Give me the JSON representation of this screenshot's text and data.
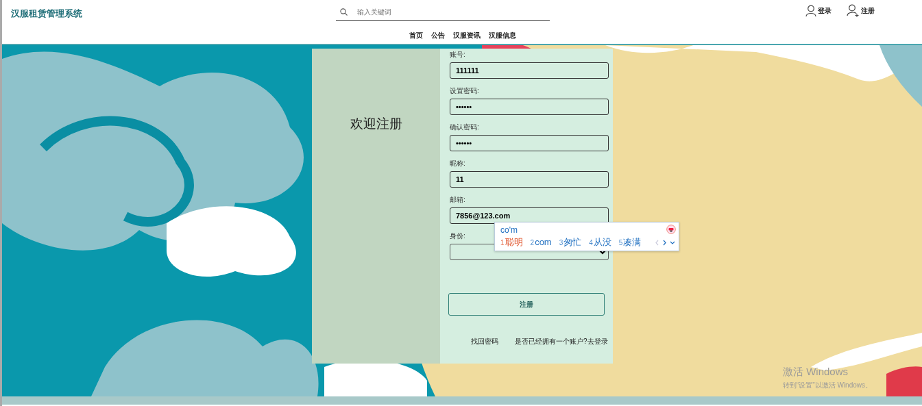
{
  "header": {
    "brand": "汉服租赁管理系统",
    "search": {
      "placeholder": "输入关键词"
    },
    "nav": [
      "首页",
      "公告",
      "汉服资讯",
      "汉服信息"
    ],
    "user_links": [
      {
        "kind": "login",
        "label": "登录"
      },
      {
        "kind": "register",
        "label": "注册"
      }
    ]
  },
  "form": {
    "title": "欢迎注册",
    "fields": [
      {
        "kind": "text",
        "label": "账号:",
        "value": "111111"
      },
      {
        "kind": "password",
        "label": "设置密码:",
        "value": "••••••"
      },
      {
        "kind": "password",
        "label": "确认密码:",
        "value": "••••••"
      },
      {
        "kind": "text",
        "label": "昵称:",
        "value": "11"
      },
      {
        "kind": "text",
        "label": "邮箱:",
        "value": "7856@123.com"
      },
      {
        "kind": "select",
        "label": "身份:"
      }
    ],
    "submit": "注册",
    "links": [
      "找回密码",
      "是否已经拥有一个账户?去登录"
    ]
  },
  "ime": {
    "composition": "co'm",
    "candidates": [
      {
        "index": "1",
        "text": "聪明",
        "selected": true
      },
      {
        "index": "2",
        "text": "com",
        "selected": false
      },
      {
        "index": "3",
        "text": "匆忙",
        "selected": false
      },
      {
        "index": "4",
        "text": "从没",
        "selected": false
      },
      {
        "index": "5",
        "text": "凑满",
        "selected": false
      }
    ]
  },
  "os_notice": {
    "title": "激活 Windows",
    "text": "转到“设置”以激活 Windows。"
  }
}
